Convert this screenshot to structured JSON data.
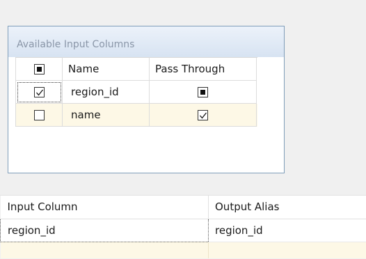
{
  "available_input_columns": {
    "title": "Available Input Columns",
    "headers": {
      "select_all_state": "indeterminate",
      "name": "Name",
      "pass_through": "Pass Through"
    },
    "rows": [
      {
        "selected": "checked",
        "name": "region_id",
        "pass_through": "indeterminate"
      },
      {
        "selected": "unchecked",
        "name": "name",
        "pass_through": "checked"
      }
    ]
  },
  "mapping_grid": {
    "headers": {
      "input_column": "Input Column",
      "output_alias": "Output Alias"
    },
    "rows": [
      {
        "input_column": "region_id",
        "output_alias": "region_id"
      }
    ]
  },
  "colors": {
    "background": "#f0f0f0",
    "box_border": "#7f9db9",
    "selected_row": "#fdf8e6",
    "title_text": "#8a96a8"
  }
}
